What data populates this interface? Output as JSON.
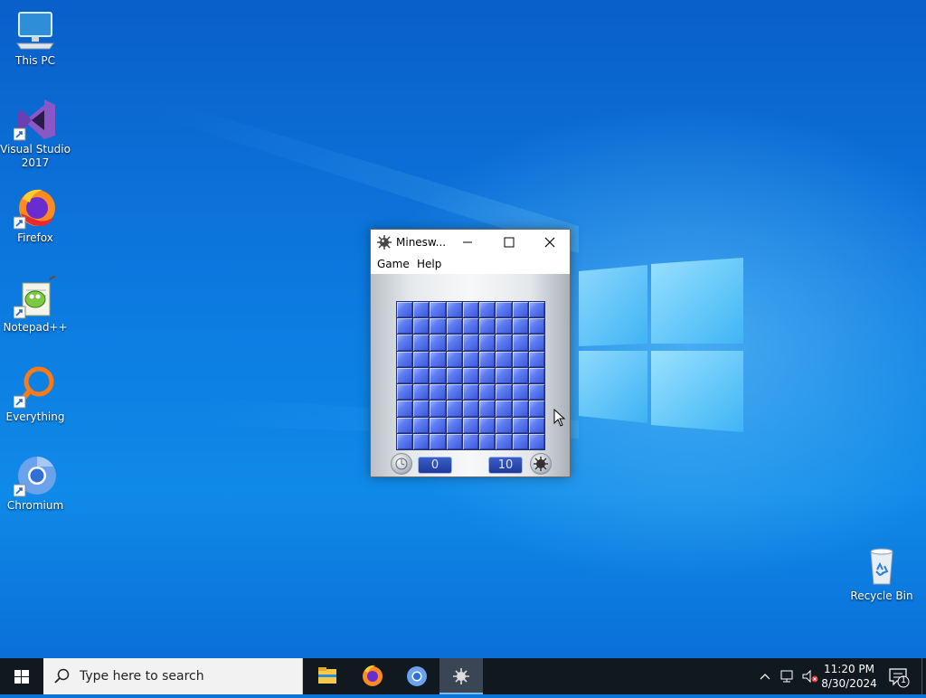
{
  "desktop": {
    "icons": [
      {
        "label": "This PC",
        "icon": "computer-icon"
      },
      {
        "label": "Visual Studio 2017",
        "icon": "visual-studio-icon"
      },
      {
        "label": "Firefox",
        "icon": "firefox-icon"
      },
      {
        "label": "Notepad++",
        "icon": "notepadpp-icon"
      },
      {
        "label": "Everything",
        "icon": "everything-search-icon"
      },
      {
        "label": "Chromium",
        "icon": "chromium-icon"
      },
      {
        "label": "Recycle Bin",
        "icon": "recycle-bin-icon"
      }
    ]
  },
  "window": {
    "title": "Minesw...",
    "menu": [
      "Game",
      "Help"
    ],
    "grid": {
      "rows": 9,
      "cols": 9
    },
    "timer": "0",
    "mines_counter": "10"
  },
  "taskbar": {
    "search_placeholder": "Type here to search",
    "apps": [
      "file-explorer-icon",
      "firefox-icon",
      "chromium-icon",
      "minesweeper-icon"
    ],
    "active_app": "minesweeper-icon",
    "time": "11:20 PM",
    "date": "8/30/2024",
    "notification_count": "1"
  },
  "colors": {
    "desktop_blue": "#0a74d9",
    "taskbar": "#101820",
    "tile_blue": "#4a64e0"
  }
}
